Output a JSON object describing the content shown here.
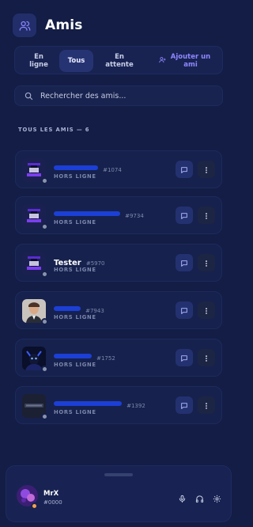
{
  "header": {
    "title": "Amis",
    "icon": "users-icon"
  },
  "tabs": [
    {
      "label": "En ligne",
      "active": false
    },
    {
      "label": "Tous",
      "active": true
    },
    {
      "label": "En attente",
      "active": false
    },
    {
      "label": "Ajouter un ami",
      "active": false,
      "icon": "user-plus-icon"
    }
  ],
  "search": {
    "placeholder": "Rechercher des amis..."
  },
  "section": {
    "title": "TOUS LES AMIS — 6"
  },
  "friends": [
    {
      "name": "",
      "tag": "#1074",
      "status": "HORS LIGNE",
      "redacted": true,
      "avatar": "pixel-logo-avatar"
    },
    {
      "name": "",
      "tag": "#9734",
      "status": "HORS LIGNE",
      "redacted": true,
      "avatar": "pixel-logo-avatar"
    },
    {
      "name": "Tester",
      "tag": "#5970",
      "status": "HORS LIGNE",
      "redacted": false,
      "avatar": "pixel-logo-avatar"
    },
    {
      "name": "",
      "tag": "#7943",
      "status": "HORS LIGNE",
      "redacted": true,
      "avatar": "photo-avatar"
    },
    {
      "name": "",
      "tag": "#1752",
      "status": "HORS LIGNE",
      "redacted": true,
      "avatar": "dark-character-avatar"
    },
    {
      "name": "",
      "tag": "#1392",
      "status": "HORS LIGNE",
      "redacted": true,
      "avatar": "text-logo-avatar"
    }
  ],
  "user": {
    "name": "MrX",
    "tag": "#0000",
    "status_color": "#f4a24a"
  },
  "colors": {
    "background": "#131d45",
    "card": "#16214d",
    "accent": "#8e86ff",
    "redaction": "#1c3fd6",
    "offline": "#8a93ad"
  }
}
